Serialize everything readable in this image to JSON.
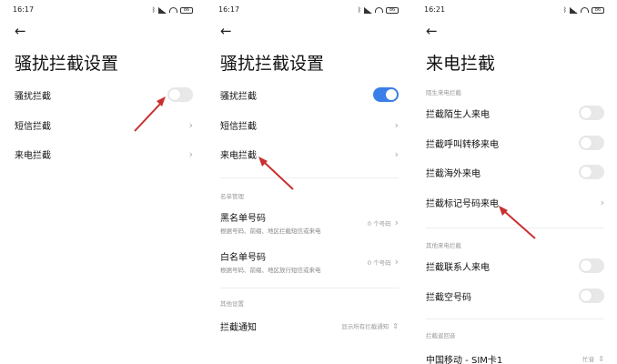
{
  "colors": {
    "accent": "#3a7fe8",
    "arrow": "#c8302f"
  },
  "panel1": {
    "time": "16:17",
    "battery": "86",
    "title": "骚扰拦截设置",
    "items": [
      {
        "label": "骚扰拦截",
        "toggle": "off"
      },
      {
        "label": "短信拦截"
      },
      {
        "label": "来电拦截"
      }
    ]
  },
  "panel2": {
    "time": "16:17",
    "battery": "86",
    "title": "骚扰拦截设置",
    "items": [
      {
        "label": "骚扰拦截",
        "toggle": "on"
      },
      {
        "label": "短信拦截"
      },
      {
        "label": "来电拦截"
      }
    ],
    "section_list": "名单管理",
    "blacklist": {
      "label": "黑名单号码",
      "sub": "根据号码、前缀、地区拦截短信或来电",
      "count": "0 个号码"
    },
    "whitelist": {
      "label": "白名单号码",
      "sub": "根据号码、前缀、地区放行短信或来电",
      "count": "0 个号码"
    },
    "section_other": "其他设置",
    "notify": {
      "label": "拦截通知",
      "value": "显示所有拦截通知"
    }
  },
  "panel3": {
    "time": "16:21",
    "battery": "86",
    "title": "来电拦截",
    "section_stranger": "陌生来电拦截",
    "stranger_items": [
      {
        "label": "拦截陌生人来电"
      },
      {
        "label": "拦截呼叫转移来电"
      },
      {
        "label": "拦截海外来电"
      },
      {
        "label": "拦截标记号码来电"
      }
    ],
    "section_other": "其他来电拦截",
    "other_items": [
      {
        "label": "拦截联系人来电"
      },
      {
        "label": "拦截空号码"
      }
    ],
    "section_response": "拦截返回音",
    "sim": {
      "label": "中国移动 - SIM卡1",
      "value": "忙音"
    }
  }
}
